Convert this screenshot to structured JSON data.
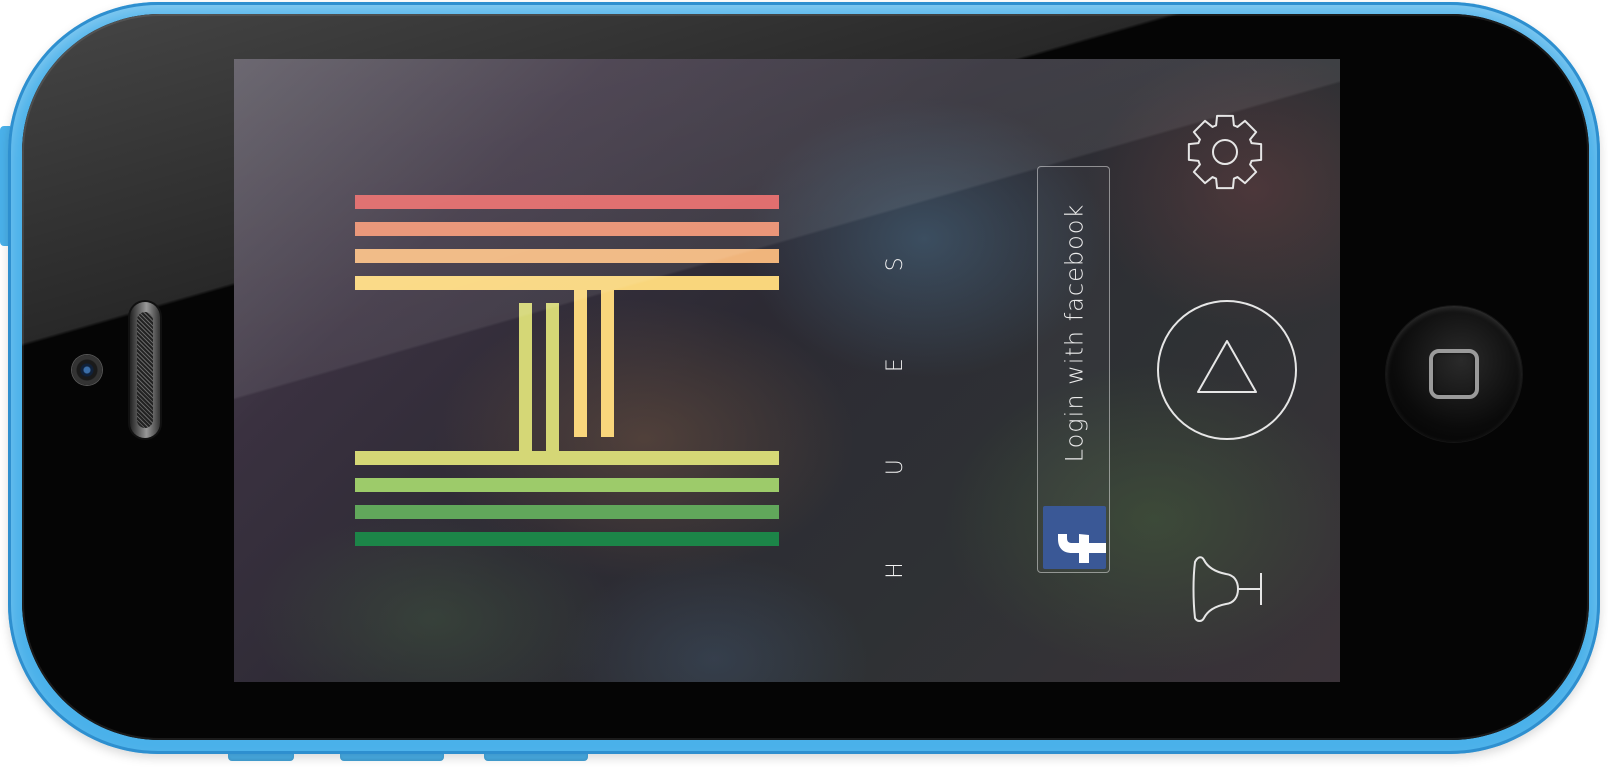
{
  "app": {
    "title": "HUES",
    "login_button_label": "Login with facebook"
  },
  "icons": {
    "facebook": "facebook-f-icon",
    "settings": "gear-icon",
    "play": "triangle-play-icon",
    "notifications": "bell-icon"
  },
  "colors": {
    "phone_case": "#4ab1ea",
    "facebook_blue": "#3a5896",
    "logo_stripes": [
      "#dd6262",
      "#e88d6d",
      "#f0b57c",
      "#f9d67c",
      "#d5d776",
      "#9dcb6a",
      "#61a75b",
      "#1c8548"
    ]
  }
}
